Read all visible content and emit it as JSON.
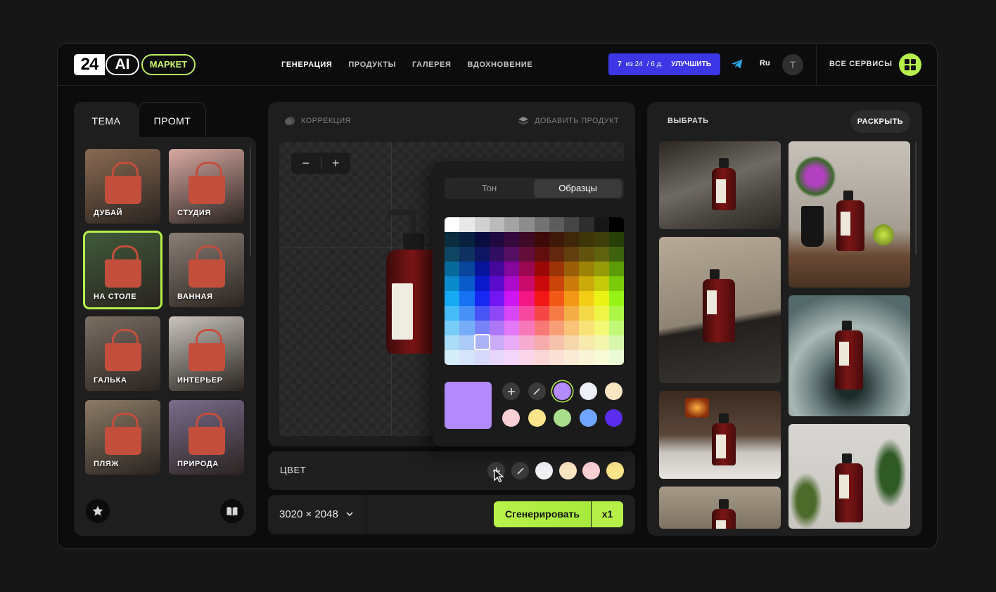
{
  "header": {
    "logo_num": "24",
    "logo_ai": "AI",
    "market": "МАРКЕТ",
    "nav": [
      "ГЕНЕРАЦИЯ",
      "ПРОДУКТЫ",
      "ГАЛЕРЕЯ",
      "ВДОХНОВЕНИЕ"
    ],
    "quota_count": "7",
    "quota_of": "из 24",
    "quota_days": "/ 6 д.",
    "upgrade": "УЛУЧШИТЬ",
    "lang": "Ru",
    "avatar_letter": "T",
    "all_services": "ВСЕ СЕРВИСЫ"
  },
  "left": {
    "tab_theme": "ТЕМА",
    "tab_prompt": "ПРОМТ",
    "themes": [
      {
        "label": "ДУБАЙ",
        "bg": "#8a6a52"
      },
      {
        "label": "СТУДИЯ",
        "bg": "#d8a9a3"
      },
      {
        "label": "НА СТОЛЕ",
        "bg": "#3f5a3a",
        "selected": true
      },
      {
        "label": "ВАННАЯ",
        "bg": "#8b7f76"
      },
      {
        "label": "ГАЛЬКА",
        "bg": "#7b6e63"
      },
      {
        "label": "ИНТЕРЬЕР",
        "bg": "#c9c4bd"
      },
      {
        "label": "ПЛЯЖ",
        "bg": "#8b7a66"
      },
      {
        "label": "ПРИРОДА",
        "bg": "#7a6c8c"
      }
    ],
    "icons": [
      "star-icon",
      "book-icon"
    ]
  },
  "center": {
    "correction": "КОРРЕКЦИЯ",
    "add_product": "ДОБАВИТЬ ПРОДУКТ",
    "zoom_out": "−",
    "zoom_in": "+",
    "color_label": "ЦВЕТ",
    "resolution": "3020 × 2048",
    "generate": "Сгенерировать",
    "multiplier": "x1",
    "color_row_swatches": [
      "#f2f2f5",
      "#fbe6c2",
      "#fbd0d4",
      "#fbe48a"
    ]
  },
  "picker": {
    "tab_tone": "Тон",
    "tab_samples": "Образцы",
    "selected_color": "#b38aff",
    "swatches_row1": [
      "add",
      "none",
      "#b38aff",
      "#eef0f8",
      "#fbe6c2"
    ],
    "swatches_row2": [
      "#fbd0d4",
      "#fbe48a",
      "#a8de8c",
      "#6fa5ff",
      "#5a2df0"
    ]
  },
  "right": {
    "select": "ВЫБРАТЬ",
    "expand": "РАСКРЫТЬ"
  }
}
